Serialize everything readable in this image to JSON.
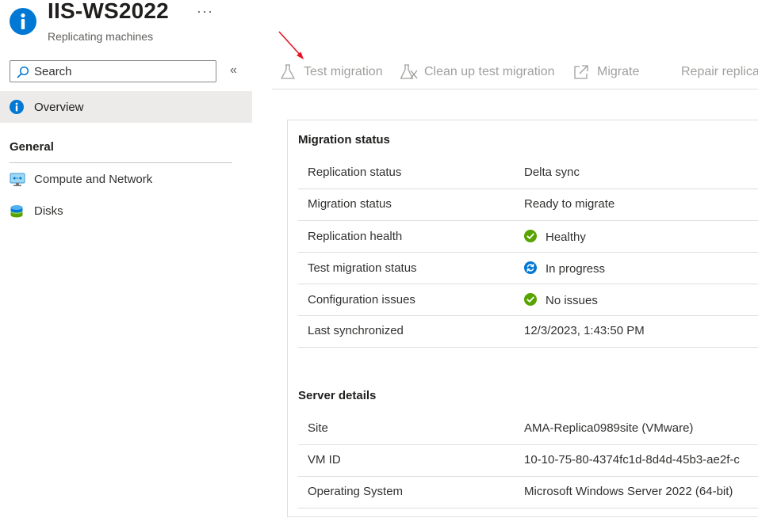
{
  "header": {
    "title": "IIS-WS2022",
    "subtitle": "Replicating machines",
    "more_label": "···"
  },
  "sidebar": {
    "search_placeholder": "Search",
    "collapse_label": "«",
    "overview_label": "Overview",
    "group_title": "General",
    "items": [
      {
        "label": "Compute and Network",
        "icon": "network-icon"
      },
      {
        "label": "Disks",
        "icon": "disks-icon"
      }
    ]
  },
  "toolbar": {
    "test_migration": "Test migration",
    "cleanup_test_migration": "Clean up test migration",
    "migrate": "Migrate",
    "repair_replication": "Repair replica"
  },
  "migration_status": {
    "title": "Migration status",
    "rows": [
      {
        "key": "Replication status",
        "value": "Delta sync",
        "icon": ""
      },
      {
        "key": "Migration status",
        "value": "Ready to migrate",
        "icon": ""
      },
      {
        "key": "Replication health",
        "value": "Healthy",
        "icon": "check-icon"
      },
      {
        "key": "Test migration status",
        "value": "In progress",
        "icon": "sync-icon"
      },
      {
        "key": "Configuration issues",
        "value": "No issues",
        "icon": "check-icon"
      },
      {
        "key": "Last synchronized",
        "value": "12/3/2023, 1:43:50 PM",
        "icon": ""
      }
    ]
  },
  "server_details": {
    "title": "Server details",
    "rows": [
      {
        "key": "Site",
        "value": "AMA-Replica0989site (VMware)"
      },
      {
        "key": "VM ID",
        "value": "10-10-75-80-4374fc1d-8d4d-45b3-ae2f-c"
      },
      {
        "key": "Operating System",
        "value": "Microsoft Windows Server 2022 (64-bit)"
      }
    ]
  },
  "colors": {
    "accent": "#0078d4",
    "success": "#57a300",
    "annotation_arrow": "#e81123"
  }
}
